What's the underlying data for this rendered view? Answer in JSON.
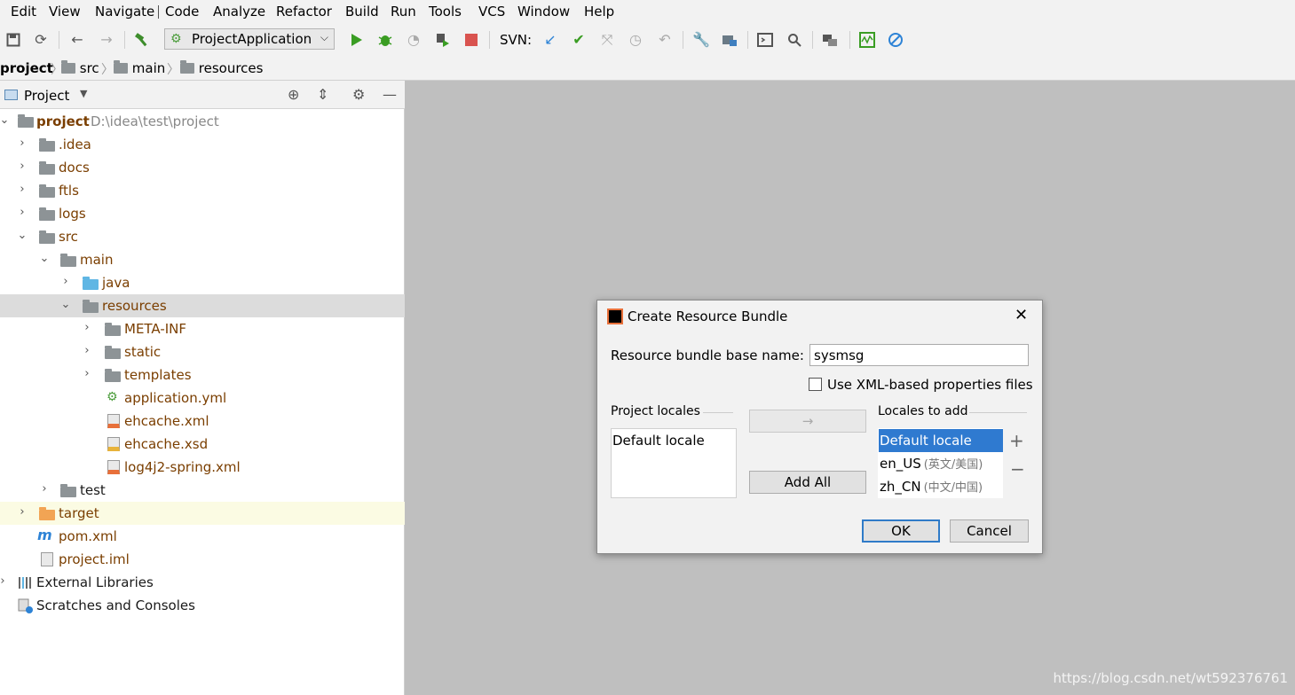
{
  "menu": [
    "Edit",
    "View",
    "Navigate",
    "Code",
    "Analyze",
    "Refactor",
    "Build",
    "Run",
    "Tools",
    "VCS",
    "Window",
    "Help"
  ],
  "toolbar": {
    "run_config": "ProjectApplication",
    "svn_label": "SVN:"
  },
  "breadcrumb": [
    "project",
    "src",
    "main",
    "resources"
  ],
  "project_panel": {
    "title": "Project",
    "tree": [
      {
        "label": "project",
        "path": "D:\\idea\\test\\project"
      },
      {
        "label": ".idea"
      },
      {
        "label": "docs"
      },
      {
        "label": "ftls"
      },
      {
        "label": "logs"
      },
      {
        "label": "src"
      },
      {
        "label": "main"
      },
      {
        "label": "java"
      },
      {
        "label": "resources"
      },
      {
        "label": "META-INF"
      },
      {
        "label": "static"
      },
      {
        "label": "templates"
      },
      {
        "label": "application.yml"
      },
      {
        "label": "ehcache.xml"
      },
      {
        "label": "ehcache.xsd"
      },
      {
        "label": "log4j2-spring.xml"
      },
      {
        "label": "test"
      },
      {
        "label": "target"
      },
      {
        "label": "pom.xml"
      },
      {
        "label": "project.iml"
      },
      {
        "label": "External Libraries"
      },
      {
        "label": "Scratches and Consoles"
      }
    ]
  },
  "dialog": {
    "title": "Create Resource Bundle",
    "base_name_label": "Resource bundle base name:",
    "base_name_value": "sysmsg",
    "xml_checkbox_label": "Use XML-based properties files",
    "project_locales_label": "Project locales",
    "locales_to_add_label": "Locales to add",
    "project_locales": [
      "Default locale"
    ],
    "locales_to_add": [
      {
        "code": "Default locale",
        "native": ""
      },
      {
        "code": "en_US",
        "native": "(英文/美国)"
      },
      {
        "code": "zh_CN",
        "native": "(中文/中国)"
      }
    ],
    "add_all_label": "Add All",
    "ok_label": "OK",
    "cancel_label": "Cancel"
  },
  "watermark": "https://blog.csdn.net/wt592376761"
}
